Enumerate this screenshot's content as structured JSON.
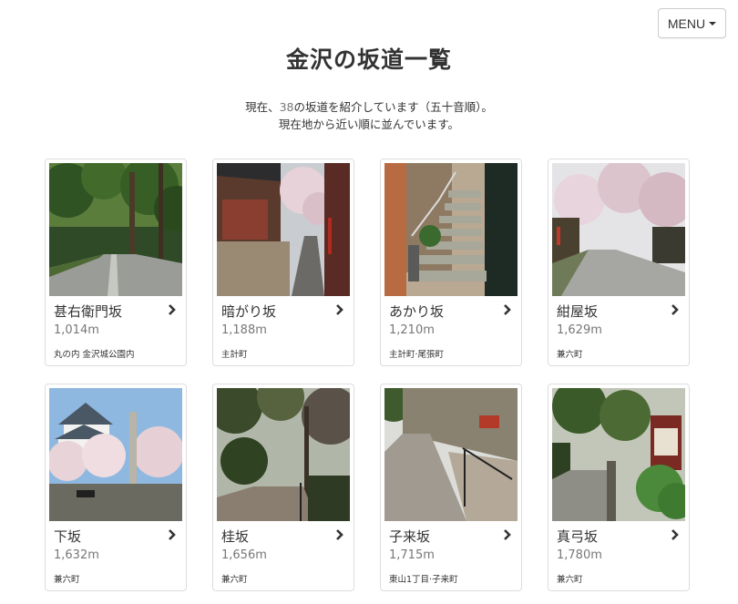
{
  "header": {
    "menu_label": "MENU",
    "title": "金沢の坂道一覧"
  },
  "intro": {
    "prefix": "現在、",
    "count": "38",
    "suffix": "の坂道を紹介しています（五十音順）。",
    "line2": "現在地から近い順に並んでいます。"
  },
  "slopes": [
    {
      "name": "甚右衛門坂",
      "distance": "1,014m",
      "area": "丸の内 金沢城公園内",
      "scene": "forest-road"
    },
    {
      "name": "暗がり坂",
      "distance": "1,188m",
      "area": "主計町",
      "scene": "old-houses-sakura"
    },
    {
      "name": "あかり坂",
      "distance": "1,210m",
      "area": "主計町·尾張町",
      "scene": "stone-stairs"
    },
    {
      "name": "紺屋坂",
      "distance": "1,629m",
      "area": "兼六町",
      "scene": "sakura-road"
    },
    {
      "name": "下坂",
      "distance": "1,632m",
      "area": "兼六町",
      "scene": "castle-sakura"
    },
    {
      "name": "桂坂",
      "distance": "1,656m",
      "area": "兼六町",
      "scene": "park-path"
    },
    {
      "name": "子来坂",
      "distance": "1,715m",
      "area": "東山1丁目·子来町",
      "scene": "stone-wall-slope"
    },
    {
      "name": "真弓坂",
      "distance": "1,780m",
      "area": "兼六町",
      "scene": "garden-gate"
    }
  ]
}
